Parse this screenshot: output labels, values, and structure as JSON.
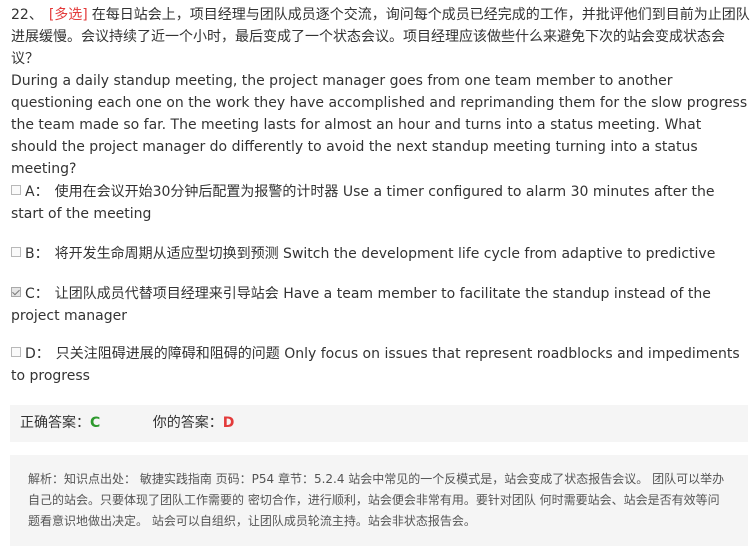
{
  "question": {
    "number": "22、",
    "type_tag": "[多选]",
    "text_cn": "在每日站会上，项目经理与团队成员逐个交流，询问每个成员已经完成的工作，并批评他们到目前为止团队进展缓慢。会议持续了近一个小时，最后变成了一个状态会议。项目经理应该做些什么来避免下次的站会变成状态会议？",
    "text_en": "During a daily standup meeting, the project manager goes from one team member to another questioning each one on the work they have accomplished and reprimanding them for the slow progress the team made so far. The meeting lasts for almost an hour and turns into a status meeting. What should the project manager do differently to avoid the next standup meeting turning into a status meeting?"
  },
  "options": [
    {
      "letter": "A：",
      "text": "使用在会议开始30分钟后配置为报警的计时器 Use a timer configured to alarm 30 minutes after the start of the meeting",
      "checked": false
    },
    {
      "letter": "B：",
      "text": "将开发生命周期从适应型切换到预测 Switch the development life cycle from adaptive to predictive",
      "checked": false
    },
    {
      "letter": "C：",
      "text": "让团队成员代替项目经理来引导站会 Have a team member to facilitate the standup instead of the project manager",
      "checked": true
    },
    {
      "letter": "D：",
      "text": "只关注阻碍进展的障碍和阻碍的问题 Only focus on issues that represent roadblocks and impediments to progress",
      "checked": false
    }
  ],
  "answer": {
    "correct_label": "正确答案：",
    "correct_value": "C",
    "yours_label": "你的答案：",
    "yours_value": "D"
  },
  "analysis": {
    "text": "解析：知识点出处： 敏捷实践指南 页码：P54 章节：5.2.4 站会中常见的一个反模式是，站会变成了状态报告会议。 团队可以举办自己的站会。只要体现了团队工作需要的 密切合作，进行顺利，站会便会非常有用。要针对团队 何时需要站会、站会是否有效等问题看意识地做出决定。 站会可以自组织，让团队成员轮流主持。站会非状态报告会。"
  },
  "colors": {
    "type_tag": "#e33b3b",
    "correct": "#2e9a2e",
    "wrong": "#e33b3b",
    "panel_bg": "#f5f5f5"
  }
}
